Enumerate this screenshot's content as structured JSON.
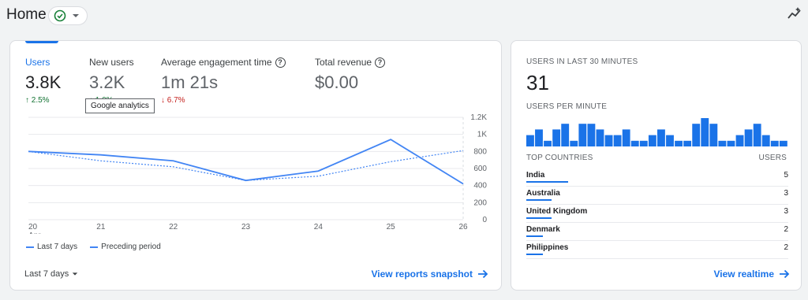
{
  "header": {
    "title": "Home"
  },
  "metrics": [
    {
      "label": "Users",
      "value": "3.8K",
      "delta": "2.5%",
      "direction": "up",
      "help": false
    },
    {
      "label": "New users",
      "value": "3.2K",
      "delta": "1.0%",
      "direction": "up",
      "help": false
    },
    {
      "label": "Average engagement time",
      "value": "1m 21s",
      "delta": "6.7%",
      "direction": "down",
      "help": true
    },
    {
      "label": "Total revenue",
      "value": "$0.00",
      "delta": "",
      "direction": "",
      "help": true
    }
  ],
  "tooltip": {
    "text": "Google analytics"
  },
  "chart_data": {
    "type": "line",
    "x": [
      "20",
      "21",
      "22",
      "23",
      "24",
      "25",
      "26"
    ],
    "x_sublabel": "Apr",
    "y_ticks": [
      "1.2K",
      "1K",
      "800",
      "600",
      "400",
      "200",
      "0"
    ],
    "ylim": [
      0,
      1200
    ],
    "series": [
      {
        "name": "Last 7 days",
        "values": [
          800,
          760,
          690,
          460,
          570,
          940,
          420
        ],
        "style": "solid"
      },
      {
        "name": "Preceding period",
        "values": [
          800,
          690,
          620,
          460,
          510,
          680,
          810
        ],
        "style": "dashed"
      }
    ],
    "grid": true,
    "legend": "bottom-left"
  },
  "legend": {
    "current": "Last 7 days",
    "previous": "Preceding period"
  },
  "range": {
    "label": "Last 7 days"
  },
  "snapshot": {
    "label": "View reports snapshot"
  },
  "realtime": {
    "heading": "USERS IN LAST 30 MINUTES",
    "count": "31",
    "per_minute_label": "USERS PER MINUTE",
    "per_minute_values": [
      2,
      3,
      1,
      3,
      4,
      1,
      4,
      4,
      3,
      2,
      2,
      3,
      1,
      1,
      2,
      3,
      2,
      1,
      1,
      4,
      5,
      4,
      1,
      1,
      2,
      3,
      4,
      2,
      1,
      1
    ],
    "countries_label": "TOP COUNTRIES",
    "users_label": "USERS",
    "countries": [
      {
        "name": "India",
        "users": "5",
        "share": 1.0
      },
      {
        "name": "Australia",
        "users": "3",
        "share": 0.6
      },
      {
        "name": "United Kingdom",
        "users": "3",
        "share": 0.6
      },
      {
        "name": "Denmark",
        "users": "2",
        "share": 0.4
      },
      {
        "name": "Philippines",
        "users": "2",
        "share": 0.4
      }
    ],
    "link_label": "View realtime"
  },
  "colors": {
    "accent": "#1a73e8",
    "series": "#4285f4",
    "up": "#137333",
    "down": "#c5221f"
  }
}
